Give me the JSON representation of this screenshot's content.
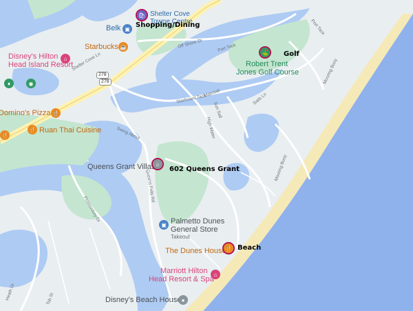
{
  "map": {
    "colors": {
      "water": "#aecbf3",
      "ocean": "#8fb2ec",
      "land": "#e9eef1",
      "green": "#c4e5cf",
      "beach": "#f6e9b8",
      "road": "#ffffff",
      "highway": "#fff2af",
      "callout_ring": "#b0124f"
    },
    "pois": {
      "shelter_cove": "Shelter Cove Towne Centre",
      "belk": "Belk",
      "starbucks": "Starbucks",
      "disneys_hilton_1": "Disney's Hilton",
      "disneys_hilton_2": "Head Island Resort",
      "dominos": "Domino's Pizza",
      "ruan_thai": "Ruan Thai Cuisine",
      "robert_trent_1": "Robert Trent",
      "robert_trent_2": "Jones Golf Course",
      "queens_grant_villas": "Queens Grant Villas",
      "palmetto_1": "Palmetto Dunes",
      "palmetto_2": "General Store",
      "palmetto_sub": "Takeout",
      "dunes_house": "The Dunes House",
      "marriott_1": "Marriott Hilton",
      "marriott_2": "Head Resort & Spa",
      "disneys_beach_house": "Disney's Beach House"
    },
    "callouts": {
      "shopping": "Shopping/Dining",
      "golf": "Golf",
      "queens_grant": "602 Queens Grant",
      "beach": "Beach"
    },
    "streets": {
      "off_shore": "Off Shore Dr",
      "port_tack": "Port Tack",
      "starboard_tack": "Starboard Tack",
      "mainsail": "Mainsail",
      "sun_sail": "Sun Sail",
      "sails_ln": "Sails Ln",
      "swing_about": "Swing About",
      "high_water": "High Water",
      "mooring_buoy_1": "Mooring Buoy",
      "mooring_buoy_2": "Mooring Buoy",
      "queens_folly": "Queens Folly Rd",
      "promontory": "Promontory Dr",
      "shelter_cove_ln": "Shelter Cove Ln",
      "route_278": "278",
      "route_278b": "278",
      "heath": "Heath Dr",
      "tsb": "Tsb St"
    },
    "icons": {
      "shopping": "shopping-bag-icon",
      "golf": "golf-icon",
      "home": "home-icon",
      "food": "restaurant-icon",
      "coffee": "coffee-icon",
      "hotel": "hotel-icon",
      "store": "store-icon",
      "camera": "camera-icon"
    }
  }
}
